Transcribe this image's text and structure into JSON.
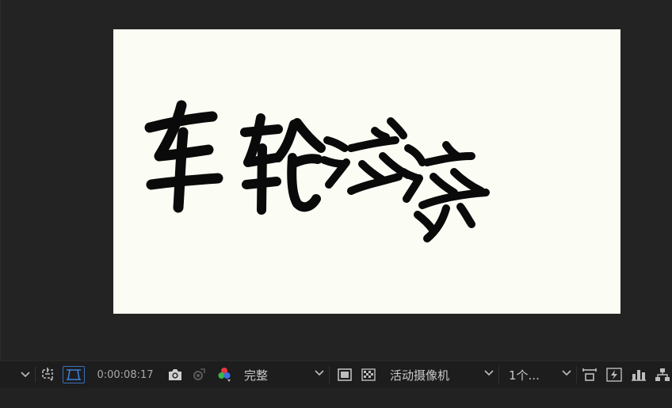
{
  "composition": {
    "text": "车轮滚滚",
    "text_color": "#0a0a0a",
    "canvas_color": "#fbfcf4"
  },
  "toolbar": {
    "timecode": "0:00:08:17",
    "resolution": "完整",
    "view": "活动摄像机",
    "views_count": "1个...",
    "icons": [
      "chevron-down-icon",
      "region-of-interest-icon",
      "transparency-grid-icon",
      "camera-snapshot-icon",
      "show-snapshot-icon",
      "color-channels-icon",
      "fit-to-frame-icon",
      "checkerboard-icon",
      "reset-exposure-icon",
      "fast-preview-icon",
      "timeline-icon",
      "flowchart-icon"
    ],
    "accent_color": "#3c7fd9"
  }
}
